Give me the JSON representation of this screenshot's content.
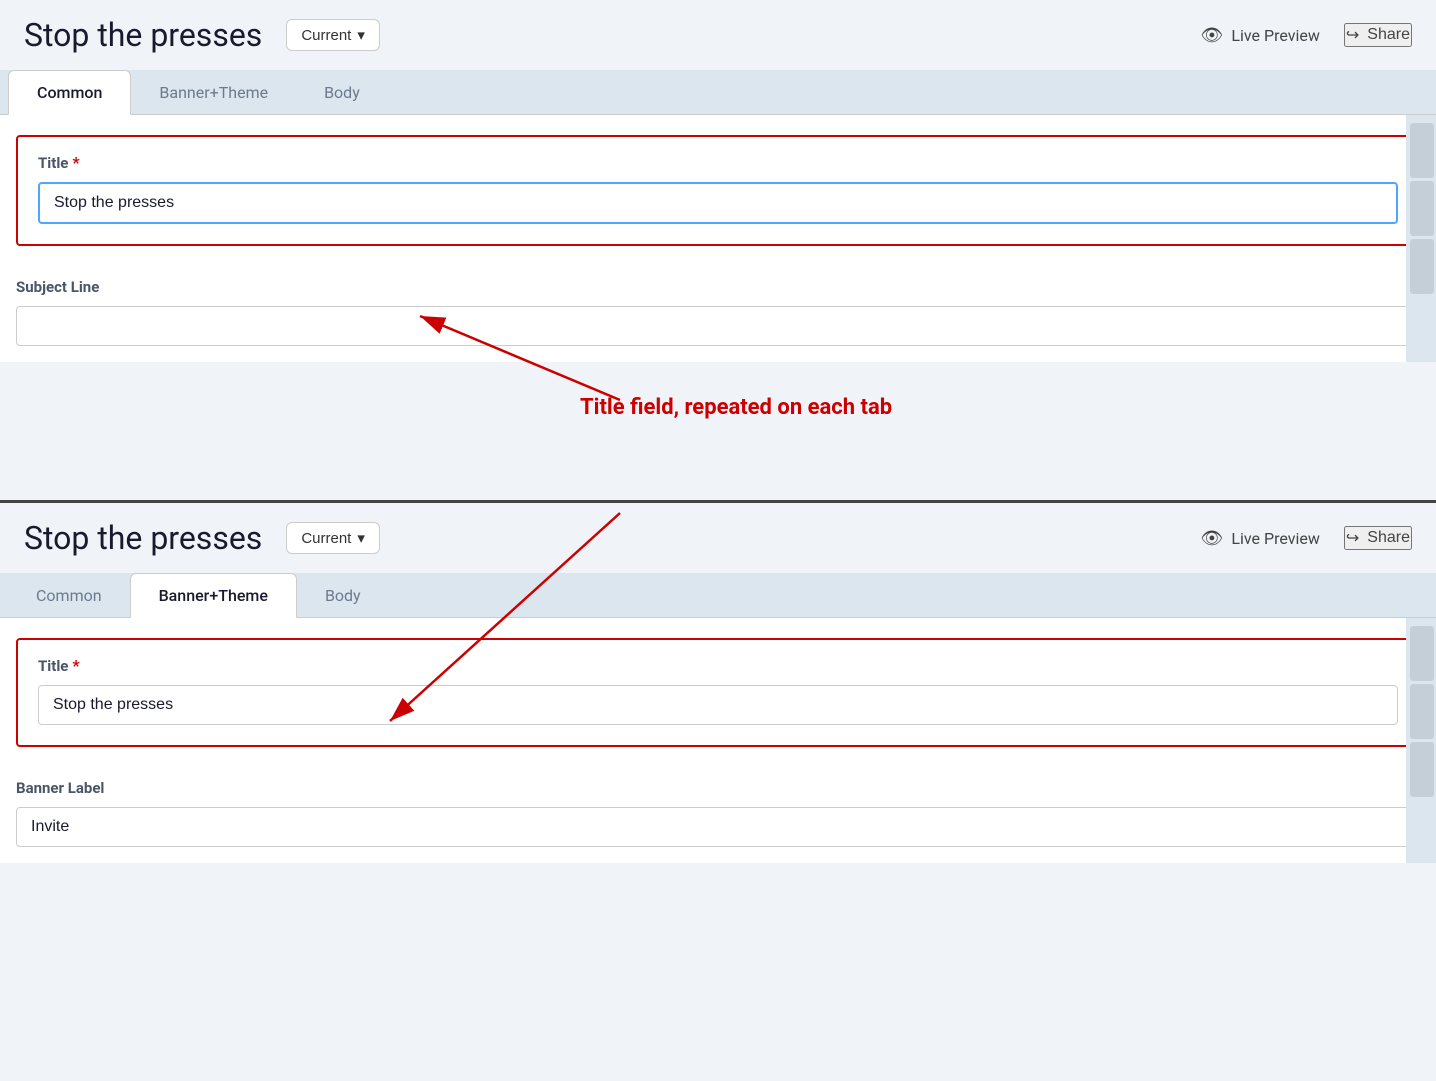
{
  "app": {
    "title": "Stop the presses"
  },
  "header": {
    "title": "Stop the presses",
    "version_label": "Current",
    "version_chevron": "▾",
    "live_preview_label": "Live Preview",
    "share_label": "Share"
  },
  "tabs": {
    "common_label": "Common",
    "banner_theme_label": "Banner+Theme",
    "body_label": "Body"
  },
  "top_panel": {
    "active_tab": "common",
    "title_field_label": "Title",
    "title_required": "*",
    "title_value": "Stop the presses",
    "subject_line_label": "Subject Line",
    "subject_line_value": ""
  },
  "bottom_panel": {
    "active_tab": "banner_theme",
    "title_field_label": "Title",
    "title_required": "*",
    "title_value": "Stop the presses",
    "banner_label_label": "Banner Label",
    "banner_label_value": "Invite"
  },
  "annotation": {
    "text": "Title field, repeated on each tab"
  }
}
